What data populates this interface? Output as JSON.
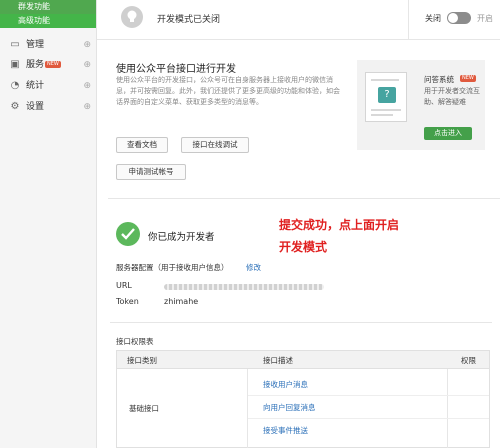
{
  "sidebar": {
    "subitems": [
      {
        "label": "群发功能"
      },
      {
        "label": "高级功能"
      }
    ],
    "items": [
      {
        "label": "管理",
        "icon": "folder-icon"
      },
      {
        "label": "服务",
        "icon": "service-icon",
        "badge": "NEW"
      },
      {
        "label": "统计",
        "icon": "chart-icon"
      },
      {
        "label": "设置",
        "icon": "gear-icon"
      }
    ]
  },
  "topbar": {
    "title": "开发模式已关闭",
    "off_label": "关闭",
    "on_label": "开启"
  },
  "intro": {
    "title": "使用公众平台接口进行开发",
    "description": "使用公众平台的开发接口，公众号可在自身服务器上接收用户的微信消息，并可按需回复。此外，我们还提供了更多更高级的功能和体验，如会话界面的自定义菜单、获取更多类型的消息等。",
    "buttons": {
      "docs": "查看文档",
      "debug": "接口在线调试",
      "test_account": "申请测试帐号"
    }
  },
  "promo": {
    "title": "问答系统",
    "badge": "NEW",
    "description": "用于开发者交流互助、解答疑难",
    "cta": "点击进入"
  },
  "status": {
    "text": "你已成为开发者",
    "annotation_line1": "提交成功，点上面开启",
    "annotation_line2": "开发模式"
  },
  "server_config": {
    "title": "服务器配置（用于接收用户信息）",
    "edit": "修改",
    "url_label": "URL",
    "token_label": "Token",
    "token_value": "zhimahe"
  },
  "permissions": {
    "title": "接口权限表",
    "headers": [
      "接口类别",
      "接口描述",
      "权限"
    ],
    "category": "基础接口",
    "rows": [
      "接收用户消息",
      "向用户回复消息",
      "接受事件推送"
    ]
  },
  "colors": {
    "accent_green": "#44b549",
    "link_blue": "#2a6fb8",
    "annotation_red": "#e02020"
  }
}
